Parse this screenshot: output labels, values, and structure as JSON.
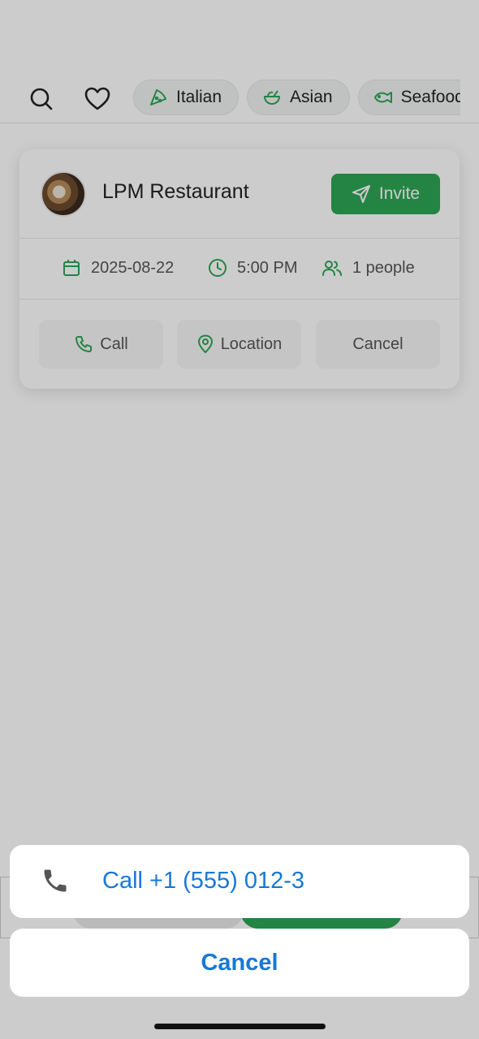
{
  "filters": {
    "chips": [
      {
        "label": "Italian",
        "icon": "pizza-icon"
      },
      {
        "label": "Asian",
        "icon": "bowl-icon"
      },
      {
        "label": "Seafood",
        "icon": "fish-icon"
      }
    ]
  },
  "reservation": {
    "restaurant_name": "LPM Restaurant",
    "invite_label": "Invite",
    "date": "2025-08-22",
    "time": "5:00 PM",
    "party": "1 people",
    "actions": {
      "call": "Call",
      "location": "Location",
      "cancel": "Cancel"
    }
  },
  "action_sheet": {
    "call_label": "Call +1 (555) 012-3",
    "cancel_label": "Cancel"
  },
  "colors": {
    "accent_green": "#2ea556",
    "ios_blue": "#1778d6",
    "overlay": "rgba(0,0,0,0.2)"
  }
}
